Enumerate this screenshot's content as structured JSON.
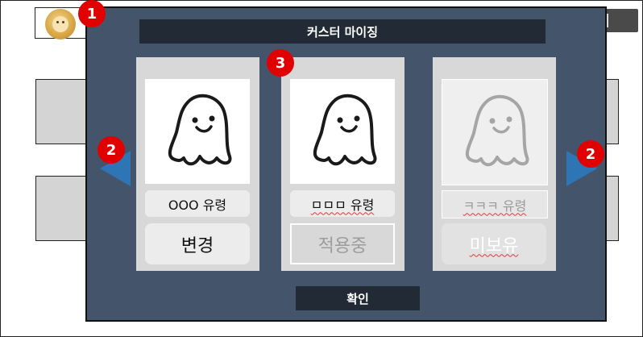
{
  "modal": {
    "title": "커스터 마이징",
    "confirm_label": "확인"
  },
  "cards": [
    {
      "name": "OOO 유령",
      "action": "변경",
      "state": "default"
    },
    {
      "name": "ㅁㅁㅁ 유령",
      "action": "적용중",
      "state": "applied"
    },
    {
      "name": "ㅋㅋㅋ 유령",
      "action": "미보유",
      "state": "locked"
    }
  ],
  "markers": {
    "profile": "1",
    "nav_left": "2",
    "nav_right": "2",
    "cards": "3"
  },
  "colors": {
    "overlay": "#44546a",
    "dark_bar": "#222a35",
    "arrow": "#2e75b6",
    "marker": "#e10000",
    "card": "#d8d8d8"
  },
  "icons": {
    "avatar": "doge-coin-avatar",
    "ghost": "ghost-icon",
    "prev": "left-triangle-arrow",
    "next": "right-triangle-arrow"
  }
}
